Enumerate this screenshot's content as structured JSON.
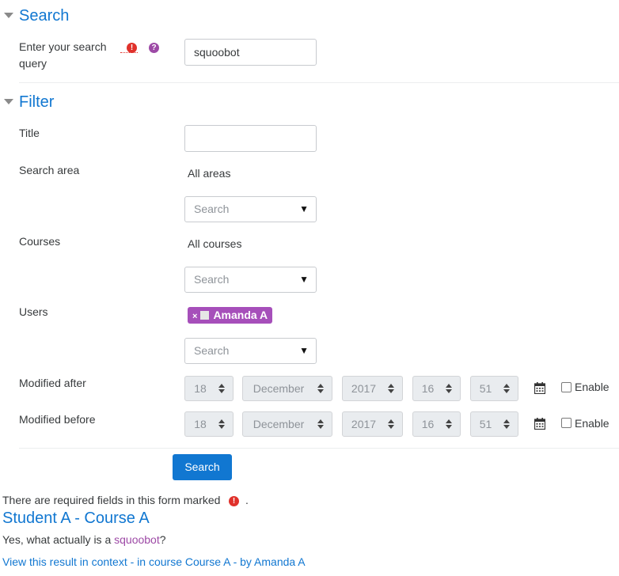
{
  "search_section": {
    "title": "Search",
    "query_label": "Enter your search query",
    "query_value": "squoobot"
  },
  "filter_section": {
    "title": "Filter",
    "title_label": "Title",
    "title_value": "",
    "search_area_label": "Search area",
    "search_area_selected": "All areas",
    "search_area_placeholder": "Search",
    "courses_label": "Courses",
    "courses_selected": "All courses",
    "courses_placeholder": "Search",
    "users_label": "Users",
    "users_chip": "Amanda A",
    "users_chip_remove": "×",
    "users_placeholder": "Search",
    "modified_after": {
      "label": "Modified after",
      "day": "18",
      "month": "December",
      "year": "2017",
      "hour": "16",
      "minute": "51",
      "enable_label": "Enable",
      "enabled": false
    },
    "modified_before": {
      "label": "Modified before",
      "day": "18",
      "month": "December",
      "year": "2017",
      "hour": "16",
      "minute": "51",
      "enable_label": "Enable",
      "enabled": false
    }
  },
  "submit_label": "Search",
  "required_note": "There are required fields in this form marked",
  "result": {
    "title": "Student A - Course A",
    "snippet_prefix": "Yes, what actually is a ",
    "snippet_highlight": "squoobot",
    "snippet_suffix": "?",
    "view_link": "View this result in context",
    "sep1": " - ",
    "course_link": "in course Course A",
    "sep2": " - ",
    "author_link": "by Amanda A"
  },
  "icons": {
    "required": "required-exclamation-icon",
    "help": "help-question-icon",
    "calendar": "calendar-icon",
    "collapse": "section-collapse-triangle-icon"
  },
  "colors": {
    "accent": "#1177d1",
    "chip": "#a64fba",
    "required": "#e0312b",
    "help": "#9d4aa6"
  }
}
